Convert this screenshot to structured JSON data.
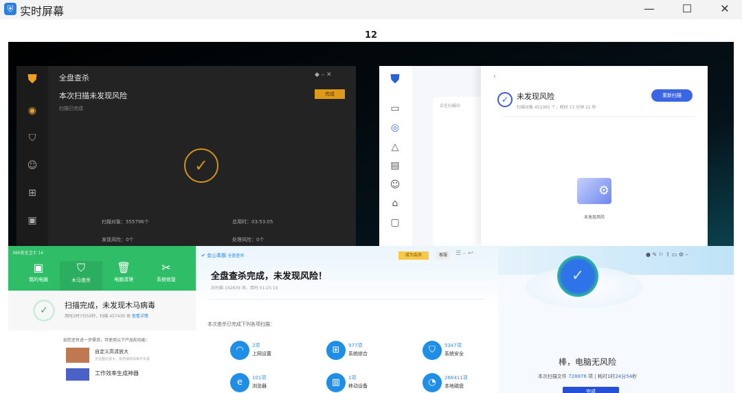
{
  "window": {
    "title": "实时屏幕",
    "minimize": "—",
    "maximize": "☐",
    "close": "✕"
  },
  "screen_label": "12",
  "w1": {
    "title": "全盘查杀",
    "headline": "本次扫描未发现风险",
    "sub": "扫描已完成",
    "done": "完成",
    "stats": [
      "扫描对象：555796个",
      "总用时：03:53:05",
      "发现风险：0个",
      "处理风险：0个"
    ]
  },
  "w2": {
    "back_panel": "正在扫描中",
    "headline": "未发现风险",
    "sub": "扫描对象 451065 个，耗时 13 分钟 22 秒",
    "rescan": "重新扫描",
    "empty": "未发现风险"
  },
  "w3": {
    "app": "360安全卫士 14",
    "tabs": [
      "我的电脑",
      "木马查杀",
      "电脑清理",
      "系统修复"
    ],
    "headline": "扫描完成，未发现木马病毒",
    "sub": "用时2时7分50秒，扫描 457430 项",
    "details": "查看详情",
    "promo": "如您还有进一步需求，可使用以下产品和功能：",
    "p1": "自定义高清放大",
    "p1sub": "无论图片放大，依然保持清晰不失真",
    "p2": "工作效率生成神器"
  },
  "w4": {
    "app": "金山毒霸",
    "mode": "全盘查杀",
    "vip": "成为会员",
    "service": "客服",
    "headline": "全盘查杀完成，未发现风险！",
    "sub": "共扫描 162839 项，用时 01:25:19",
    "intro": "本次查杀已完成下列各项扫描：",
    "items": [
      {
        "n": "2项",
        "l": "上网设置"
      },
      {
        "n": "977项",
        "l": "系统综合"
      },
      {
        "n": "5347项",
        "l": "系统安全"
      },
      {
        "n": "101项",
        "l": "浏览器"
      },
      {
        "n": "1项",
        "l": "移动设备"
      },
      {
        "n": "266411项",
        "l": "本地磁盘"
      }
    ]
  },
  "w5": {
    "headline": "棒，电脑无风险",
    "prefix": "本次扫描文件",
    "count": "728876",
    "mid": "项 | 耗时1时",
    "m1": "24",
    "m2": "分",
    "m3": "54",
    "m4": "秒",
    "done": "完成"
  }
}
